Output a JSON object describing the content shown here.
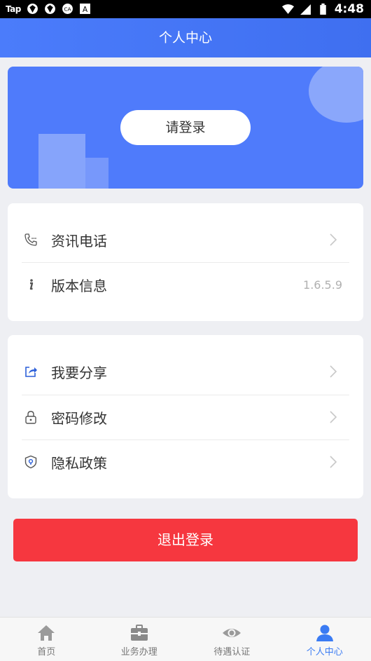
{
  "status_bar": {
    "carrier_label": "Tap",
    "time": "4:48"
  },
  "header": {
    "title": "个人中心"
  },
  "hero": {
    "login_label": "请登录"
  },
  "menu_group_1": [
    {
      "label": "资讯电话",
      "icon": "phone-icon"
    },
    {
      "label": "版本信息",
      "icon": "info-icon",
      "value": "1.6.5.9"
    }
  ],
  "menu_group_2": [
    {
      "label": "我要分享",
      "icon": "share-icon"
    },
    {
      "label": "密码修改",
      "icon": "lock-icon"
    },
    {
      "label": "隐私政策",
      "icon": "shield-icon"
    }
  ],
  "logout_label": "退出登录",
  "tabs": [
    {
      "label": "首页",
      "icon": "home-icon"
    },
    {
      "label": "业务办理",
      "icon": "briefcase-icon"
    },
    {
      "label": "待遇认证",
      "icon": "eye-icon"
    },
    {
      "label": "个人中心",
      "icon": "user-icon",
      "active": true
    }
  ],
  "colors": {
    "primary": "#4f7bfb",
    "danger": "#f6373f",
    "tab_active": "#3a7bf3"
  }
}
